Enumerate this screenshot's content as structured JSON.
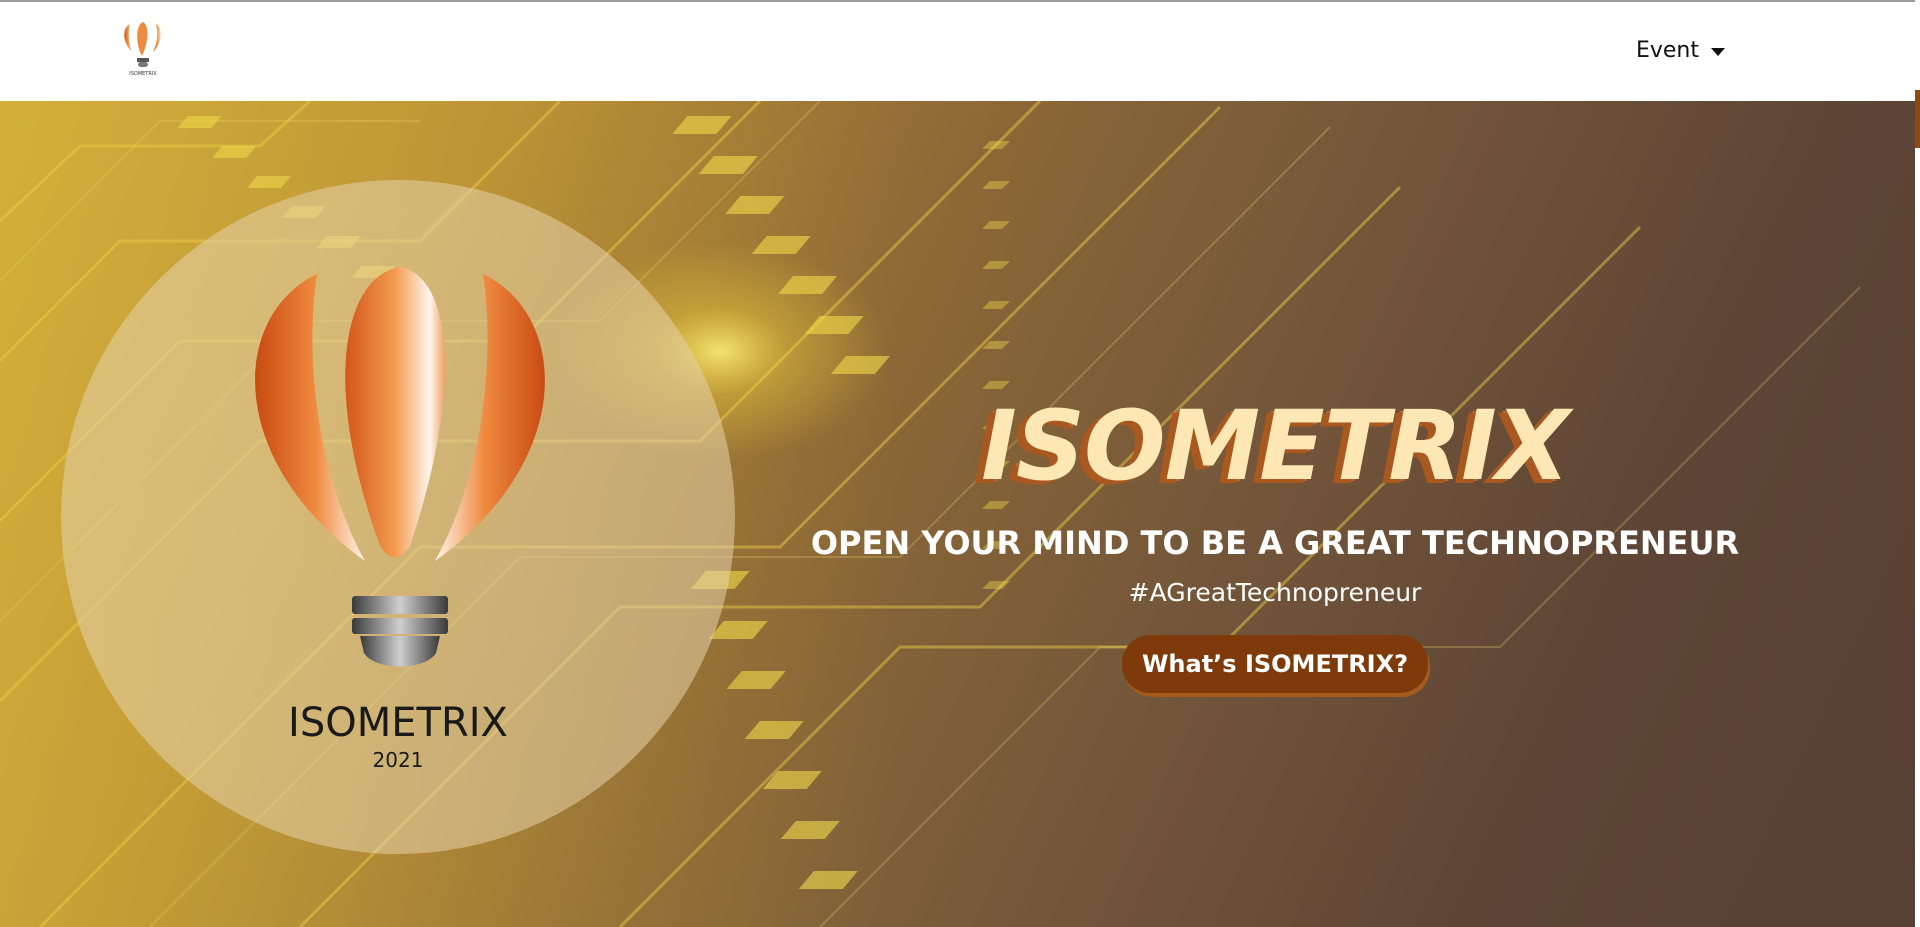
{
  "navbar": {
    "brand_caption": "ISOMETRIX",
    "menu": {
      "event_label": "Event"
    }
  },
  "hero": {
    "logo_wordmark": "ISOMETRIX",
    "logo_year": "2021",
    "title": "ISOMETRIX",
    "subtitle": "OPEN YOUR MIND TO BE A GREAT TECHNOPRENEUR",
    "hashtag": "#AGreatTechnopreneur",
    "cta_label": "What’s ISOMETRIX?"
  },
  "colors": {
    "accent_brown": "#7f3a0c",
    "title_cream": "#fde7b4",
    "balloon_orange": "#e8782f"
  },
  "icons": {
    "brand": "hot-air-balloon-lightbulb-icon",
    "dropdown": "caret-down-icon"
  }
}
